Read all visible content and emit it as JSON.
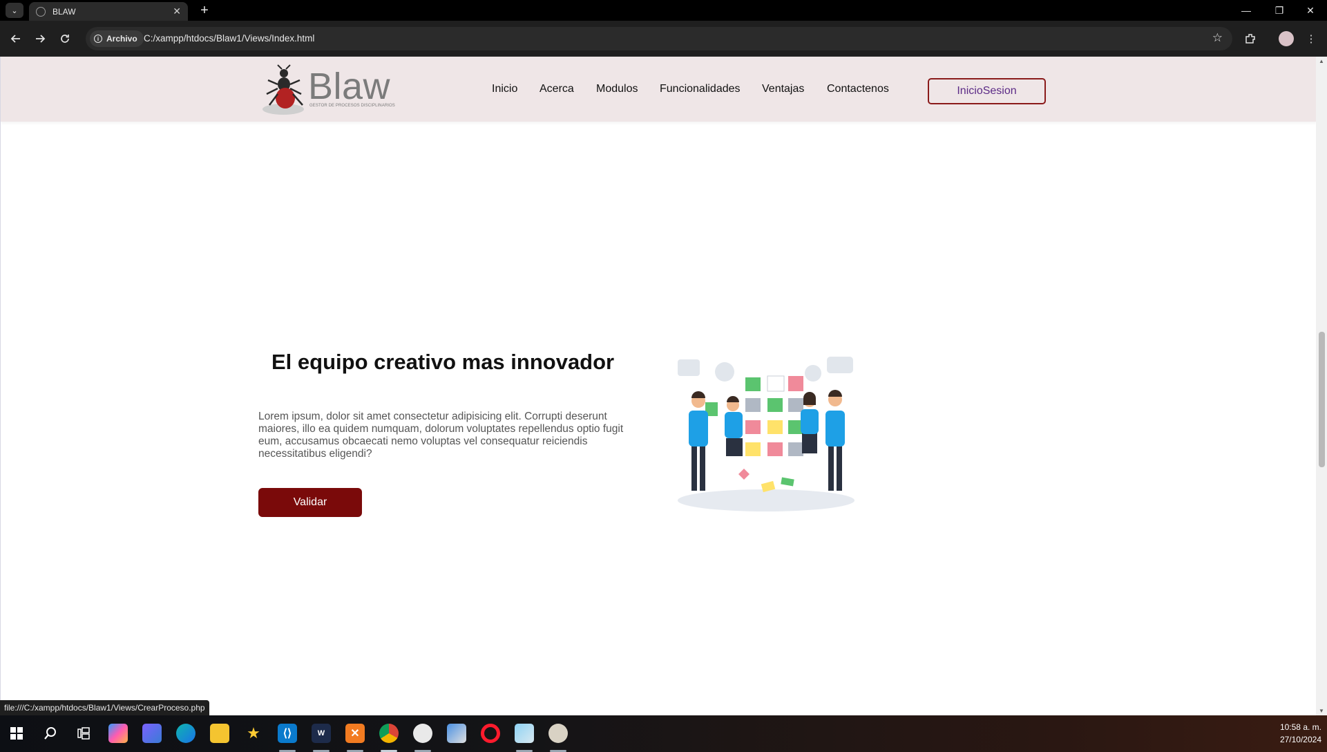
{
  "browser": {
    "tab_title": "BLAW",
    "tab_close": "✕",
    "new_tab": "+",
    "window_controls": {
      "minimize": "—",
      "restore": "❐",
      "close": "✕"
    },
    "site_chip": "Archivo",
    "url": "C:/xampp/htdocs/Blaw1/Views/Index.html",
    "status_url": "file:///C:/xampp/htdocs/Blaw1/Views/CrearProceso.php"
  },
  "site": {
    "logo_word": "Blaw",
    "logo_tagline": "GESTOR DE PROCESOS DISCIPLINARIOS",
    "nav": [
      "Inicio",
      "Acerca",
      "Modulos",
      "Funcionalidades",
      "Ventajas",
      "Contactenos"
    ],
    "login_button": "InicioSesion",
    "accent_color": "#7a0a0a"
  },
  "hero": {
    "title": "El equipo creativo mas innovador",
    "text": "Lorem ipsum, dolor sit amet consectetur adipisicing elit. Corrupti deserunt maiores, illo ea quidem numquam, dolorum voluptates repellendus optio fugit eum, accusamus obcaecati nemo voluptas vel consequatur reiciendis necessitatibus eligendi?",
    "button": "Validar",
    "image": "team-planning-illustration"
  },
  "taskbar": {
    "time": "10:58 a. m.",
    "date": "27/10/2024",
    "apps": [
      "windows-start",
      "search",
      "task-view",
      "copilot",
      "teams",
      "edge",
      "file-explorer",
      "star-app",
      "vscode",
      "rider",
      "xampp",
      "chrome",
      "paint-app",
      "box-app",
      "opera",
      "notes-app",
      "paint-palette"
    ]
  }
}
